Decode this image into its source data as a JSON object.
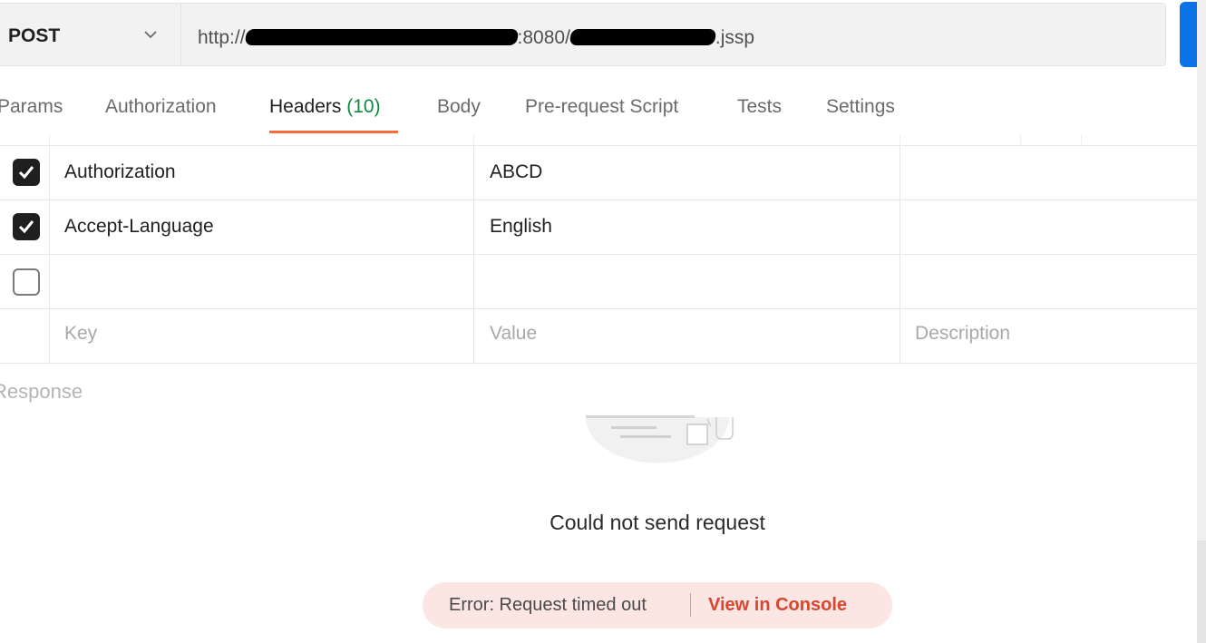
{
  "request": {
    "method": "POST",
    "url_parts": [
      "http://",
      ":8080/",
      ".jssp"
    ]
  },
  "tabs": [
    {
      "label": "Params"
    },
    {
      "label": "Authorization"
    },
    {
      "label": "Headers",
      "count": "(10)"
    },
    {
      "label": "Body"
    },
    {
      "label": "Pre-request Script"
    },
    {
      "label": "Tests"
    },
    {
      "label": "Settings"
    }
  ],
  "headers": {
    "rows": [
      {
        "checked": true,
        "key": "Authorization",
        "value": "ABCD"
      },
      {
        "checked": true,
        "key": "Accept-Language",
        "value": "English"
      },
      {
        "checked": false,
        "key": "",
        "value": ""
      }
    ],
    "placeholders": {
      "key": "Key",
      "value": "Value",
      "description": "Description"
    }
  },
  "response": {
    "title": "Response",
    "error_title": "Could not send request",
    "error_message": "Error: Request timed out",
    "console_link": "View in Console"
  },
  "colors": {
    "accent_tab": "#ff6c37",
    "send_button": "#0b72e7",
    "count_green": "#0b8a3e",
    "error_link": "#d9452e",
    "error_pill_bg": "#fce6e4"
  },
  "icons": [
    "chevron-down-icon",
    "checkbox-checked-icon",
    "checkbox-empty-icon",
    "empty-response-illustration"
  ]
}
